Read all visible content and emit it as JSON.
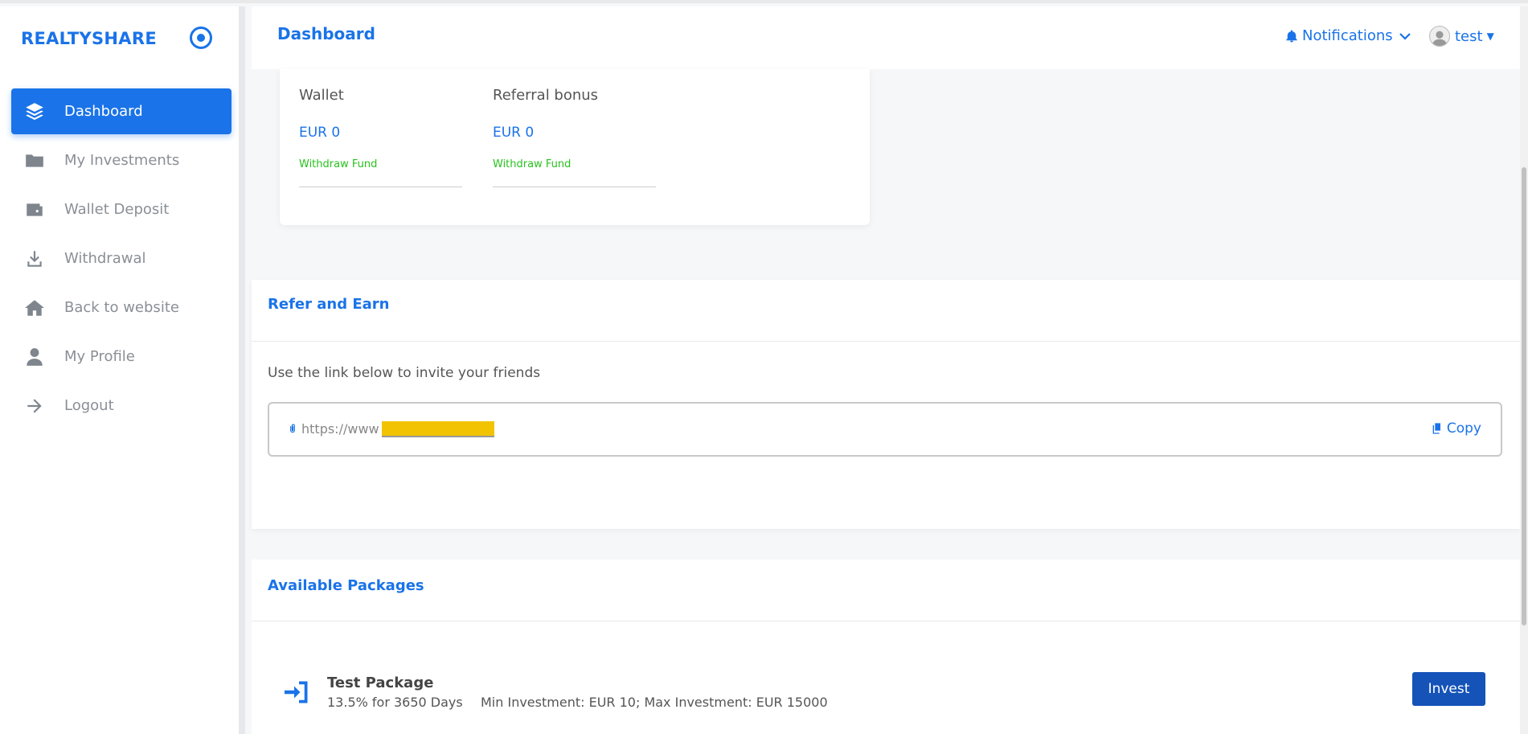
{
  "brand": "REALTYSHARE",
  "sidebar": {
    "items": [
      {
        "label": "Dashboard",
        "icon": "layers-icon",
        "active": true
      },
      {
        "label": "My Investments",
        "icon": "folder-icon"
      },
      {
        "label": "Wallet Deposit",
        "icon": "wallet-icon"
      },
      {
        "label": "Withdrawal",
        "icon": "download-icon"
      },
      {
        "label": "Back to website",
        "icon": "home-icon"
      },
      {
        "label": "My Profile",
        "icon": "user-icon"
      },
      {
        "label": "Logout",
        "icon": "arrow-right-icon"
      }
    ]
  },
  "header": {
    "title": "Dashboard",
    "notifications_label": "Notifications",
    "user_name": "test"
  },
  "wallet": {
    "wallet_label": "Wallet",
    "wallet_value": "EUR 0",
    "wallet_action": "Withdraw Fund",
    "referral_label": "Referral bonus",
    "referral_value": "EUR 0",
    "referral_action": "Withdraw Fund"
  },
  "refer": {
    "title": "Refer and Earn",
    "instructions": "Use the link below to invite your friends",
    "link_value": "https://www",
    "copy_label": "Copy"
  },
  "packages": {
    "title": "Available Packages",
    "items": [
      {
        "name": "Test Package",
        "rate": "13.5% for 3650 Days",
        "limits": "Min Investment: EUR 10; Max Investment: EUR 15000",
        "action": "Invest"
      }
    ]
  },
  "colors": {
    "accent": "#1a73e8",
    "invest_button": "#1553b8",
    "success": "#28c21e"
  }
}
